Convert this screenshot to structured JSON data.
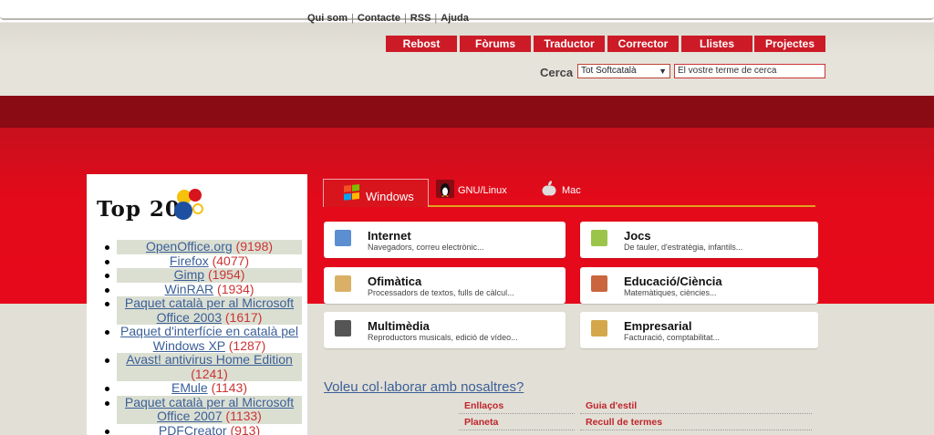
{
  "header": {
    "top_links": [
      "Qui som",
      "Contacte",
      "RSS",
      "Ajuda"
    ],
    "nav": [
      "Rebost",
      "Fòrums",
      "Traductor",
      "Corrector",
      "Llistes",
      "Projectes"
    ],
    "search": {
      "label": "Cerca",
      "scope_selected": "Tot Softcatalà",
      "placeholder": "El vostre terme de cerca"
    }
  },
  "top20": {
    "title": "Top 20",
    "items": [
      {
        "name": "OpenOffice.org",
        "count": "(9198)"
      },
      {
        "name": "Firefox",
        "count": "(4077)"
      },
      {
        "name": "Gimp",
        "count": "(1954)"
      },
      {
        "name": "WinRAR",
        "count": "(1934)"
      },
      {
        "name": "Paquet català per al Microsoft Office 2003",
        "count": "(1617)"
      },
      {
        "name": "Paquet d'interfície en català pel Windows XP",
        "count": "(1287)"
      },
      {
        "name": "Avast! antivirus Home Edition",
        "count": "(1241)"
      },
      {
        "name": "EMule",
        "count": "(1143)"
      },
      {
        "name": "Paquet català per al Microsoft Office 2007",
        "count": "(1133)"
      },
      {
        "name": "PDFCreator",
        "count": "(913)"
      }
    ]
  },
  "tabs": [
    "Windows",
    "GNU/Linux",
    "Mac"
  ],
  "categories": [
    {
      "title": "Internet",
      "desc": "Navegadors, correu electrònic...",
      "icon": "internet-icon",
      "color": "#5b8fd1"
    },
    {
      "title": "Jocs",
      "desc": "De tauler, d'estratègia, infantils...",
      "icon": "games-icon",
      "color": "#9bc54a"
    },
    {
      "title": "Ofimàtica",
      "desc": "Processadors de textos, fulls de càlcul...",
      "icon": "office-icon",
      "color": "#d9b066"
    },
    {
      "title": "Educació/Ciència",
      "desc": "Matemàtiques, ciències...",
      "icon": "education-icon",
      "color": "#c9663d"
    },
    {
      "title": "Multimèdia",
      "desc": "Reproductors musicals, edició de vídeo...",
      "icon": "multimedia-icon",
      "color": "#555555"
    },
    {
      "title": "Empresarial",
      "desc": "Facturació, comptabilitat...",
      "icon": "business-icon",
      "color": "#d4a84a"
    }
  ],
  "footer": {
    "collab_link": "Voleu col·laborar amb nosaltres?",
    "links_left": [
      "Enllaços",
      "Planeta"
    ],
    "links_right": [
      "Guia d'estil",
      "Recull de termes"
    ]
  },
  "colors": {
    "brand_red": "#cc1b27",
    "dark_red": "#8a0b13",
    "tab_underline": "#e3a11c"
  }
}
